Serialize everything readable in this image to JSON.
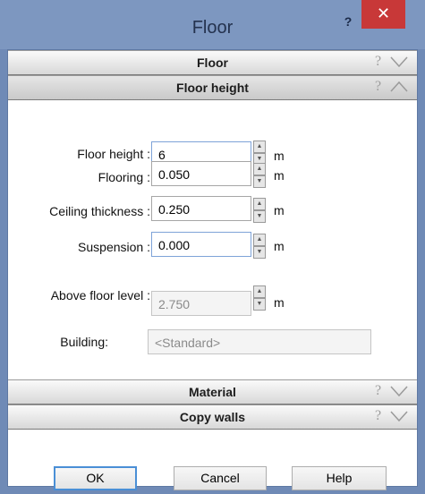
{
  "window": {
    "title": "Floor",
    "help_symbol": "?",
    "close_symbol": "✕"
  },
  "sections": {
    "floor": {
      "label": "Floor",
      "help_glyph": "?",
      "chevron": "chevron-down"
    },
    "floor_height": {
      "label": "Floor height",
      "help_glyph": "?",
      "chevron": "chevron-up"
    },
    "material": {
      "label": "Material",
      "help_glyph": "?",
      "chevron": "chevron-down"
    },
    "copy_walls": {
      "label": "Copy walls",
      "help_glyph": "?",
      "chevron": "chevron-down"
    }
  },
  "fields": {
    "floor_height": {
      "label": "Floor height :",
      "value": "6",
      "unit": "m"
    },
    "flooring": {
      "label": "Flooring :",
      "value": "0.050",
      "unit": "m"
    },
    "ceiling_thickness": {
      "label": "Ceiling thickness :",
      "value": "0.250",
      "unit": "m"
    },
    "suspension": {
      "label": "Suspension :",
      "value": "0.000",
      "unit": "m"
    },
    "above_floor_level": {
      "label": "Above floor level :",
      "value": "2.750",
      "unit": "m"
    },
    "building": {
      "label": "Building:",
      "value": "<Standard>"
    }
  },
  "spinner_glyphs": {
    "up": "▲",
    "down": "▼"
  },
  "buttons": {
    "ok": "OK",
    "cancel": "Cancel",
    "help": "Help"
  },
  "colors": {
    "titlebar": "#7d97c0",
    "close": "#c83838",
    "section_bg": "#d8d8d8",
    "focus_border": "#4a8fd6"
  }
}
